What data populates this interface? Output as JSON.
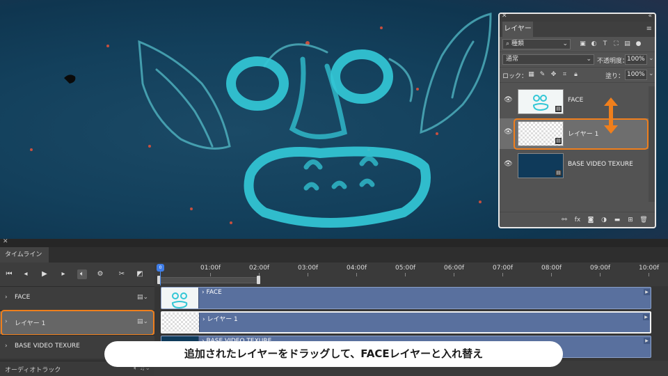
{
  "layers_panel": {
    "tab_label": "レイヤー",
    "filter": {
      "label": "種類"
    },
    "blend_mode": "通常",
    "opacity_label": "不透明度：",
    "opacity_value": "100%",
    "lock_label": "ロック：",
    "fill_label": "塗り：",
    "fill_value": "100%",
    "layers": [
      {
        "name": "FACE",
        "visible": true,
        "selected": false
      },
      {
        "name": "レイヤー 1",
        "visible": true,
        "selected": true
      },
      {
        "name": "BASE VIDEO TEXURE",
        "visible": true,
        "selected": false
      }
    ],
    "bottom_icons": [
      "link-icon",
      "fx-icon",
      "mask-icon",
      "adjustment-icon",
      "folder-icon",
      "new-layer-icon",
      "trash-icon"
    ]
  },
  "timeline": {
    "tab_label": "タイムライン",
    "ruler_labels": [
      "01:00f",
      "02:00f",
      "03:00f",
      "04:00f",
      "05:00f",
      "06:00f",
      "07:00f",
      "08:00f",
      "09:00f",
      "10:00f"
    ],
    "playhead_label": "0",
    "tracks": [
      {
        "name": "FACE",
        "clip_label": "FACE",
        "selected": false
      },
      {
        "name": "レイヤー 1",
        "clip_label": "レイヤー 1",
        "selected": true
      },
      {
        "name": "BASE VIDEO TEXURE",
        "clip_label": "BASE VIDEO TEXURE",
        "selected": false
      }
    ],
    "audio_track_label": "オーディオトラック"
  },
  "caption": "追加されたレイヤーをドラッグして、FACEレイヤーと入れ替え",
  "colors": {
    "highlight": "#f07f1c",
    "clip": "#59709e",
    "canvas": "#13405c",
    "drawing": "#33c7d6"
  }
}
